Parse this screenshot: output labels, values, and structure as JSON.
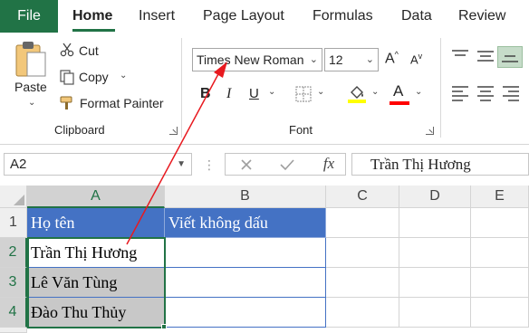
{
  "tabs": {
    "file": "File",
    "home": "Home",
    "insert": "Insert",
    "page_layout": "Page Layout",
    "formulas": "Formulas",
    "data": "Data",
    "review": "Review"
  },
  "clipboard": {
    "paste": "Paste",
    "cut": "Cut",
    "copy": "Copy",
    "format_painter": "Format Painter",
    "group_label": "Clipboard"
  },
  "font": {
    "font_name": "Times New Roman",
    "font_size": "12",
    "bold": "B",
    "italic": "I",
    "underline": "U",
    "font_color_letter": "A",
    "group_label": "Font",
    "highlight_color": "#ffff00",
    "font_color": "#ff0000"
  },
  "formula_bar": {
    "name_box": "A2",
    "fx": "fx",
    "content": "Trần Thị Hương"
  },
  "grid": {
    "columns": [
      "A",
      "B",
      "C",
      "D",
      "E"
    ],
    "rows": [
      "1",
      "2",
      "3",
      "4"
    ],
    "cells": {
      "a1": "Họ tên",
      "b1": "Viết không dấu",
      "a2": "Trần Thị Hương",
      "a3": "Lê Văn Tùng",
      "a4": "Đào Thu Thủy"
    }
  },
  "colors": {
    "accent": "#217346",
    "header_fill": "#4472c4",
    "arrow": "#e8191f"
  }
}
